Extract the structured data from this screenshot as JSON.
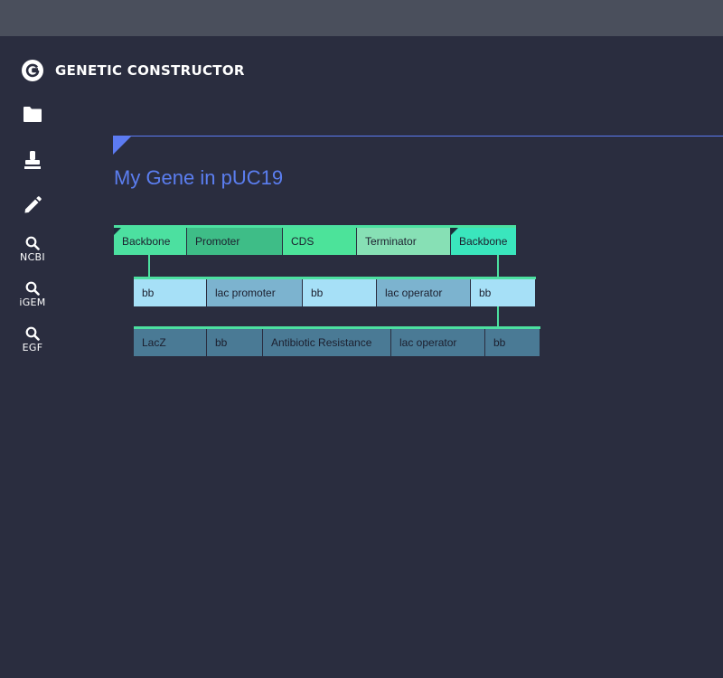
{
  "app": {
    "title": "GENETIC CONSTRUCTOR",
    "logo_icon": "genetic-constructor-logo-icon"
  },
  "sidebar": {
    "items": [
      {
        "icon": "folder-icon",
        "label": ""
      },
      {
        "icon": "stamp-icon",
        "label": ""
      },
      {
        "icon": "pencil-icon",
        "label": ""
      },
      {
        "icon": "search-icon",
        "label": "NCBI"
      },
      {
        "icon": "search-icon",
        "label": "iGEM"
      },
      {
        "icon": "search-icon",
        "label": "EGF"
      }
    ]
  },
  "construct": {
    "title": "My Gene in pUC19",
    "accent_color": "#5c7bf2"
  },
  "rows": [
    {
      "blocks": [
        {
          "label": "Backbone",
          "color": "#4ce0a0",
          "flag": true
        },
        {
          "label": "Promoter",
          "color": "#3ebd87",
          "flag": false
        },
        {
          "label": "CDS",
          "color": "#4ce39a",
          "flag": false
        },
        {
          "label": "Terminator",
          "color": "#87e0b5",
          "flag": false
        },
        {
          "label": "Backbone",
          "color": "#3ae6bd",
          "flag": true
        }
      ]
    },
    {
      "blocks": [
        {
          "label": "bb",
          "color": "#a6e0f7",
          "flag": false
        },
        {
          "label": "lac promoter",
          "color": "#7cb3cf",
          "flag": false
        },
        {
          "label": "bb",
          "color": "#a6e0f7",
          "flag": false
        },
        {
          "label": "lac operator",
          "color": "#7cb3cf",
          "flag": false
        },
        {
          "label": "bb",
          "color": "#a6e0f7",
          "flag": false
        }
      ]
    },
    {
      "blocks": [
        {
          "label": "LacZ",
          "color": "#4a7a95",
          "flag": false
        },
        {
          "label": "bb",
          "color": "#4a7a95",
          "flag": false
        },
        {
          "label": "Antibiotic Resistance",
          "color": "#4a7a95",
          "flag": false
        },
        {
          "label": "lac operator",
          "color": "#4a7a95",
          "flag": false
        },
        {
          "label": "bb",
          "color": "#4a7a95",
          "flag": false
        }
      ]
    }
  ]
}
